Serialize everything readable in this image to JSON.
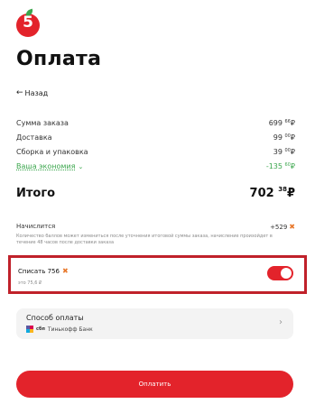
{
  "brand": {
    "logo_text": "5",
    "color": "#e3232b",
    "leaf_color": "#3aa64c"
  },
  "page_title": "Оплата",
  "back_label": "Назад",
  "summary": [
    {
      "label": "Сумма заказа",
      "whole": "699",
      "frac": "66",
      "currency": "₽"
    },
    {
      "label": "Доставка",
      "whole": "99",
      "frac": "00",
      "currency": "₽"
    },
    {
      "label": "Сборка и упаковка",
      "whole": "39",
      "frac": "00",
      "currency": "₽"
    },
    {
      "label": "Ваша экономия",
      "whole": "-135",
      "frac": "60",
      "currency": "₽"
    }
  ],
  "total": {
    "label": "Итого",
    "whole": "702",
    "frac": "38",
    "currency": "₽"
  },
  "bonus": {
    "earn_label": "Начислится",
    "earn_value": "+529",
    "note": "Количество баллов может измениться после уточнения итоговой суммы заказа, начисление произойдет в течение 48 часов после доставки заказа",
    "spend_label": "Списать 756",
    "spend_sub": "это 75,6 ₽",
    "spend_enabled": true
  },
  "payment": {
    "title": "Способ оплаты",
    "method": "Тинькофф Банк",
    "sbp_label": "сбп"
  },
  "pay_button_label": "Оплатить"
}
